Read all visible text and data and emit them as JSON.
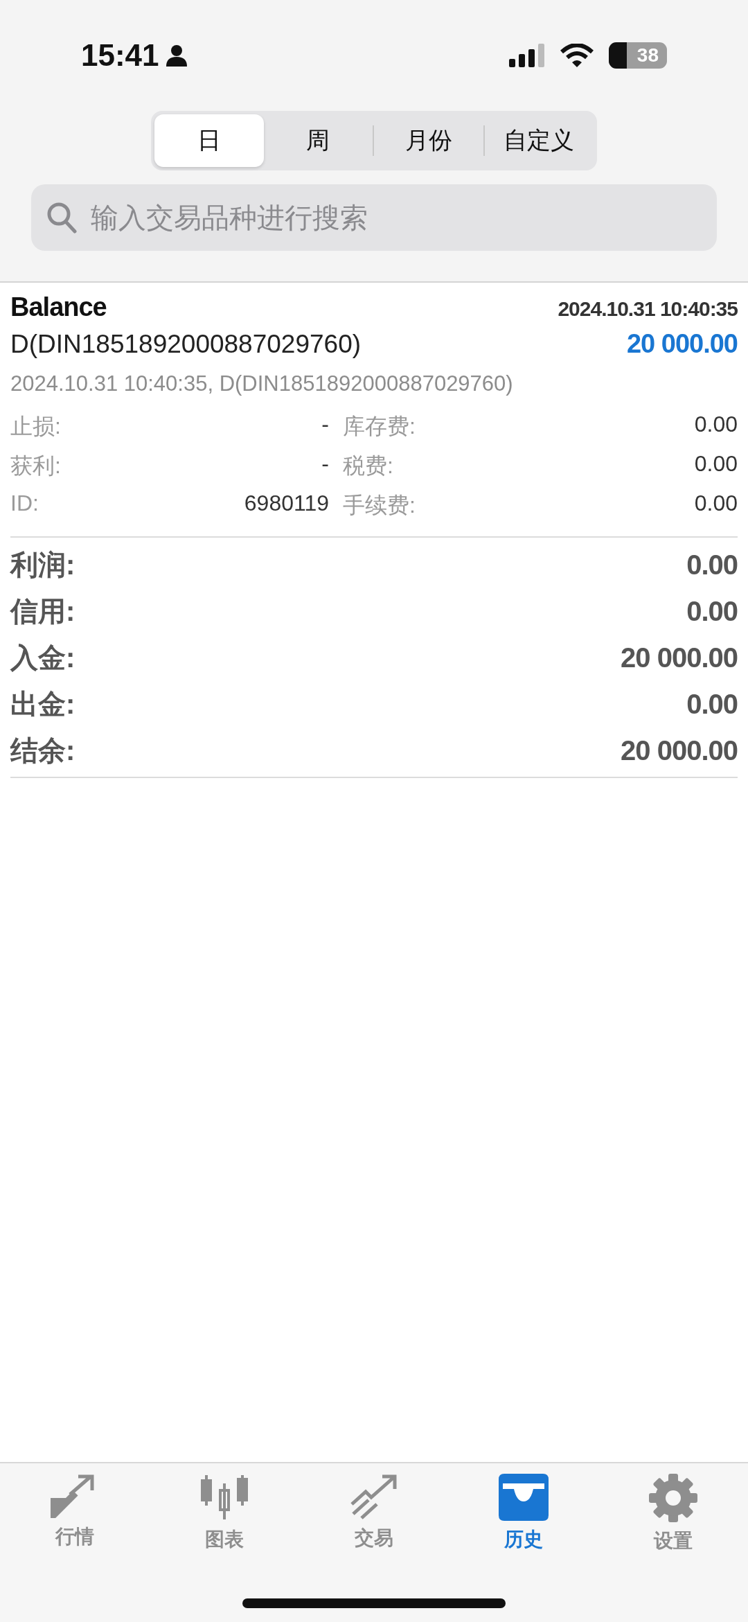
{
  "status_bar": {
    "time": "15:41",
    "battery": "38"
  },
  "period_tabs": [
    {
      "label": "日",
      "selected": true
    },
    {
      "label": "周",
      "selected": false
    },
    {
      "label": "月份",
      "selected": false
    },
    {
      "label": "自定义",
      "selected": false
    }
  ],
  "search": {
    "placeholder": "输入交易品种进行搜索"
  },
  "deal": {
    "type": "Balance",
    "time": "2024.10.31 10:40:35",
    "comment": "D(DIN1851892000887029760)",
    "amount": "20 000.00",
    "detail_line": "2024.10.31 10:40:35, D(DIN1851892000887029760)",
    "fields": [
      {
        "label": "止损:",
        "value": "-",
        "label2": "库存费:",
        "value2": "0.00"
      },
      {
        "label": "获利:",
        "value": "-",
        "label2": "税费:",
        "value2": "0.00"
      },
      {
        "label": "ID:",
        "value": "6980119",
        "label2": "手续费:",
        "value2": "0.00"
      }
    ]
  },
  "summary": [
    {
      "label": "利润:",
      "value": "0.00"
    },
    {
      "label": "信用:",
      "value": "0.00"
    },
    {
      "label": "入金:",
      "value": "20 000.00"
    },
    {
      "label": "出金:",
      "value": "0.00"
    },
    {
      "label": "结余:",
      "value": "20 000.00"
    }
  ],
  "tab_bar": [
    {
      "kind": "quotes",
      "label": "行情",
      "selected": false
    },
    {
      "kind": "chart",
      "label": "图表",
      "selected": false
    },
    {
      "kind": "trade",
      "label": "交易",
      "selected": false
    },
    {
      "kind": "history",
      "label": "历史",
      "selected": true
    },
    {
      "kind": "settings",
      "label": "设置",
      "selected": false
    }
  ]
}
